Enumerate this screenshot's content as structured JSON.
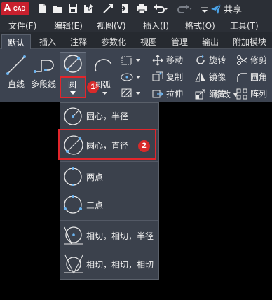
{
  "app": {
    "logo_letter": "A",
    "logo_text": "CAD",
    "share_label": "共享",
    "brand_color": "#c8202e",
    "accent_color": "#e2262c"
  },
  "quick_access": [
    "new-file-icon",
    "open-folder-icon",
    "save-icon",
    "save-as-icon",
    "publish-icon",
    "export-icon",
    "print-icon",
    "undo-icon",
    "redo-icon",
    "share-icon"
  ],
  "menu": {
    "items": [
      "文件(F)",
      "编辑(E)",
      "视图(V)",
      "插入(I)",
      "格式(O)",
      "工具(T)"
    ]
  },
  "ribbon_tabs": {
    "items": [
      "默认",
      "插入",
      "注释",
      "参数化",
      "视图",
      "管理",
      "输出",
      "附加模块"
    ],
    "active": "默认"
  },
  "draw": {
    "line_label": "直线",
    "polyline_label": "多段线",
    "circle_label": "圆",
    "arc_label": "圆弧"
  },
  "modify": {
    "move": "移动",
    "rotate": "旋转",
    "trim": "修剪",
    "copy": "复制",
    "mirror": "镜像",
    "fillet": "圆角",
    "stretch": "拉伸",
    "scale": "缩放",
    "array": "阵列",
    "panel_title": "修改 ▾"
  },
  "circle_menu": {
    "items": [
      "圆心，半径",
      "圆心，直径",
      "两点",
      "三点",
      "相切，相切，半径",
      "相切，相切，相切"
    ],
    "highlighted": "圆心，直径"
  },
  "annotations": {
    "step1": "1",
    "step2": "2"
  }
}
